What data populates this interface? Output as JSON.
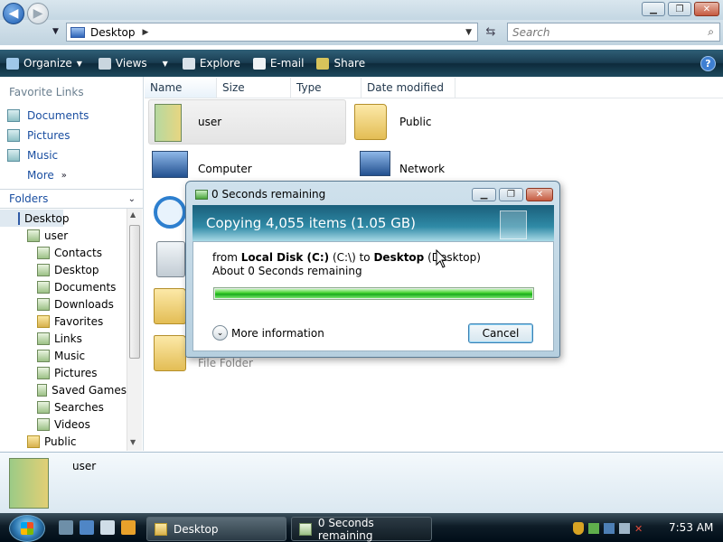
{
  "explorer": {
    "address": {
      "location": "Desktop"
    },
    "search": {
      "placeholder": "Search"
    },
    "toolbar": {
      "organize": "Organize",
      "views": "Views",
      "explore": "Explore",
      "email": "E-mail",
      "share": "Share"
    },
    "favorite_links": {
      "heading": "Favorite Links",
      "items": [
        "Documents",
        "Pictures",
        "Music"
      ],
      "more": "More"
    },
    "folders": {
      "heading": "Folders",
      "root": "Desktop",
      "user": "user",
      "user_children": [
        "Contacts",
        "Desktop",
        "Documents",
        "Downloads",
        "Favorites",
        "Links",
        "Music",
        "Pictures",
        "Saved Games",
        "Searches",
        "Videos"
      ],
      "public": "Public"
    },
    "columns": [
      "Name",
      "Size",
      "Type",
      "Date modified"
    ],
    "files": {
      "user": "user",
      "public": "Public",
      "computer": "Computer",
      "network": "Network",
      "file_folder_caption": "File Folder"
    },
    "details": {
      "selected_name": "user"
    }
  },
  "dialog": {
    "title": "0 Seconds remaining",
    "banner": "Copying 4,055 items (1.05 GB)",
    "from_prefix": "from",
    "source": "Local Disk (C:)",
    "source_path": "(C:\\)",
    "to_word": "to",
    "destination": "Desktop",
    "destination_path": "(Desktop)",
    "remaining": "About 0 Seconds remaining",
    "progress_fraction": 1.0,
    "more_info": "More information",
    "cancel": "Cancel"
  },
  "taskbar": {
    "tasks": [
      "Desktop",
      "0 Seconds remaining"
    ],
    "clock": "7:53 AM"
  },
  "colors": {
    "toolbar": "#1a3d51",
    "link": "#1b4fa1",
    "progress": "#2cc41f",
    "banner": "#1a5f7b"
  }
}
